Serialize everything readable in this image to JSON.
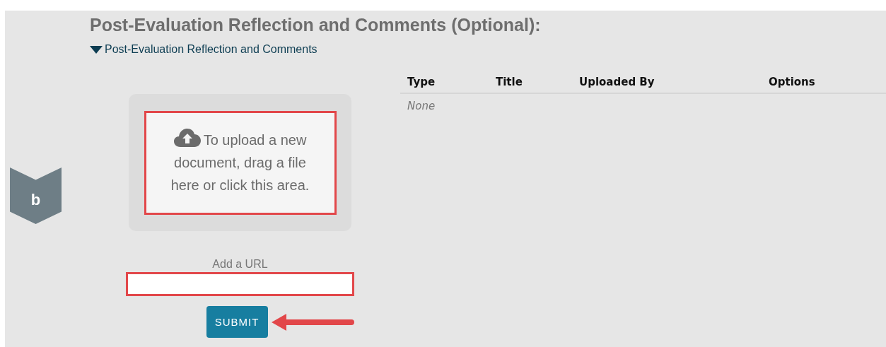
{
  "heading": "Post-Evaluation Reflection and Comments (Optional):",
  "section_toggle": {
    "label": "Post-Evaluation Reflection and Comments",
    "expanded": true
  },
  "badge": "b",
  "drop_zone": {
    "text": "To upload a new document, drag a file here or click this area.",
    "highlighted": true
  },
  "url_field": {
    "label": "Add a URL",
    "highlighted": true
  },
  "submit": {
    "label": "SUBMIT",
    "arrow_pointing": true
  },
  "table": {
    "columns": [
      "Type",
      "Title",
      "Uploaded By",
      "Options"
    ],
    "empty_text": "None"
  }
}
